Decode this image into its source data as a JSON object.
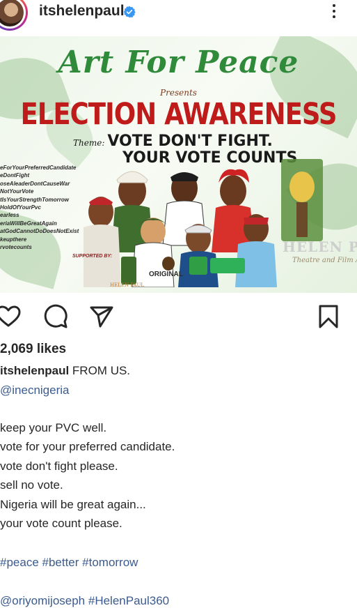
{
  "header": {
    "username": "itshelenpaul",
    "verified": true,
    "more_icon": "more-vertical-icon"
  },
  "poster": {
    "title": "Art For Peace",
    "presents": "Presents",
    "event": "ELECTION AWARENESS",
    "theme_label": "Theme:",
    "theme_line1": "VOTE DON'T FIGHT.",
    "theme_line2": "YOUR VOTE COUNTS",
    "hashtags": [
      "eForYourPreferredCandidate",
      "eDontFight",
      "oseAleaderDontCauseWar",
      "NotYourVote",
      "tIsYourStrengthTomorrow",
      "HoldOfYourPvc",
      "earless",
      "eriaWillBeGreatAgain",
      "atGodCannotDoDoesNotExist",
      "keupthere",
      "rvotecounts"
    ],
    "supported_by": "SUPPORTED BY:",
    "original_logo": "ORIGINAL",
    "helen_paul_watermark": "HELEN PAUL",
    "helen_paul_sub": "Theatre and Film Academy",
    "helen_paul_small": "HELEN PAUL",
    "colors": {
      "title_green": "#2f8a3a",
      "event_red": "#c01b1b"
    }
  },
  "actions": {
    "like_icon": "heart-icon",
    "comment_icon": "comment-icon",
    "share_icon": "send-icon",
    "save_icon": "bookmark-icon"
  },
  "post": {
    "likes": "2,069 likes",
    "caption_user": "itshelenpaul",
    "caption_text": "FROM US.",
    "mention_inec": "@inecnigeria",
    "lines": [
      "keep your PVC well.",
      "vote for your preferred candidate.",
      "vote don't fight please.",
      "sell no vote.",
      "Nigeria will be great again...",
      "your vote count please."
    ],
    "hashtags_line": "#peace #better #tomorrow",
    "mentions_line": "@oriyomijoseph #HelenPaul360"
  }
}
